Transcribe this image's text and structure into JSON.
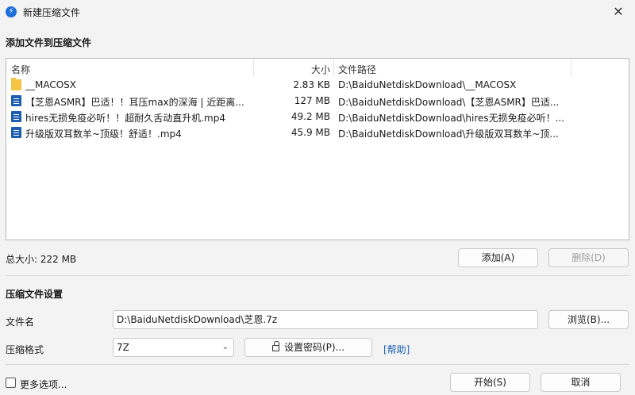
{
  "window": {
    "title": "新建压缩文件",
    "app_icon_glyph": "⚡",
    "close_glyph": "✕"
  },
  "add_section": {
    "title": "添加文件到压缩文件"
  },
  "filelist": {
    "columns": [
      "名称",
      "大小",
      "文件路径"
    ],
    "rows": [
      {
        "icon": "folder-icon",
        "name": "__MACOSX",
        "size": "2.83 KB",
        "path": "D:\\BaiduNetdiskDownload\\__MACOSX"
      },
      {
        "icon": "video-file-icon",
        "name": "【芝恩ASMR】巴适！！耳压max的深海 | 近距离...",
        "size": "127 MB",
        "path": "D:\\BaiduNetdiskDownload\\【芝恩ASMR】巴适..."
      },
      {
        "icon": "video-file-icon",
        "name": "hires无损免疫必听！！超耐久舌动直升机.mp4",
        "size": "49.2 MB",
        "path": "D:\\BaiduNetdiskDownload\\hires无损免疫必听！..."
      },
      {
        "icon": "video-file-icon",
        "name": "升级版双耳数羊~顶级！舒适！.mp4",
        "size": "45.9 MB",
        "path": "D:\\BaiduNetdiskDownload\\升级版双耳数羊~顶..."
      }
    ]
  },
  "summary": {
    "total_size": "总大小: 222 MB"
  },
  "buttons": {
    "add": "添加(A)",
    "delete": "删除(D)",
    "browse": "浏览(B)...",
    "set_password": "设置密码(P)...",
    "start": "开始(S)",
    "cancel": "取消"
  },
  "settings": {
    "title": "压缩文件设置",
    "filename_label": "文件名",
    "filename_value": "D:\\BaiduNetdiskDownload\\芝恩.7z",
    "format_label": "压缩格式",
    "format_value": "7Z",
    "help_link": "[帮助]"
  },
  "more_options": {
    "label": "更多选项...",
    "checked": false
  }
}
